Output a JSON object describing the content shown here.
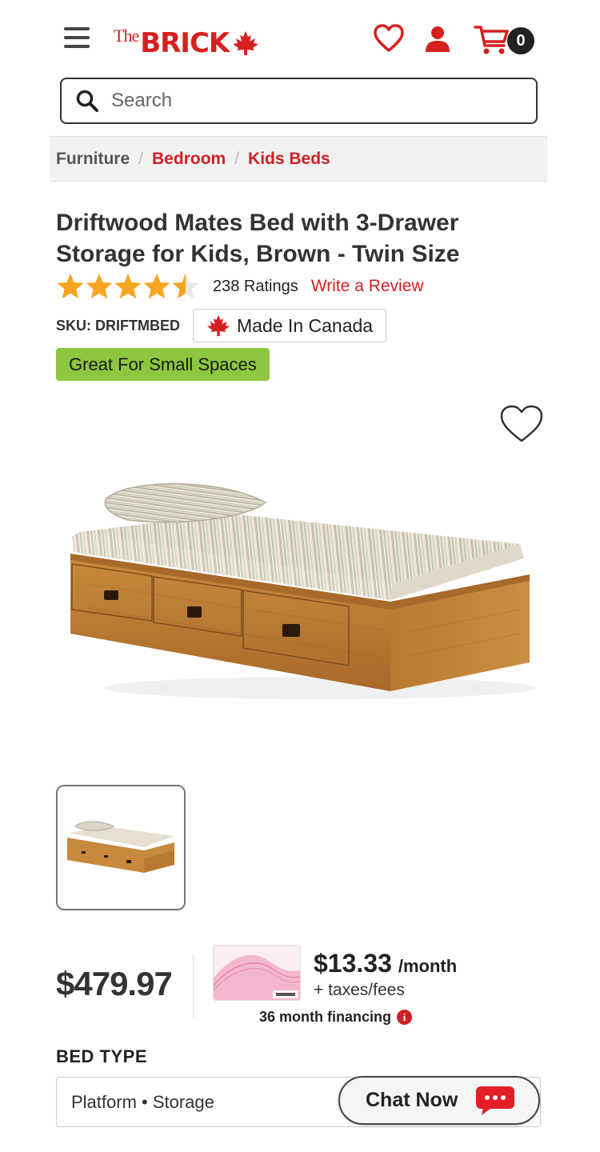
{
  "header": {
    "logo_the": "The",
    "logo_brick": "BRICK",
    "cart_count": "0",
    "menu_icon": "hamburger-menu-icon",
    "wishlist_icon": "heart-icon",
    "account_icon": "user-icon",
    "cart_icon": "cart-icon",
    "brand_color": "#d6201f"
  },
  "search": {
    "placeholder": "Search",
    "icon": "search-icon"
  },
  "breadcrumb": {
    "items": [
      {
        "label": "Furniture"
      },
      {
        "label": "Bedroom"
      },
      {
        "label": "Kids Beds"
      }
    ],
    "separator": "/"
  },
  "product": {
    "title": "Driftwood Mates Bed with 3-Drawer Storage for Kids, Brown - Twin Size",
    "rating_value": 4.5,
    "ratings_count": "238 Ratings",
    "write_review": "Write a Review",
    "sku": "SKU: DRIFTMBED",
    "made_in": "Made In Canada",
    "tag": "Great For Small Spaces",
    "tag_color": "#8dc73f",
    "price": "$479.97",
    "monthly_amount": "$13.33",
    "monthly_per": "/month",
    "taxes": "+ taxes/fees",
    "financing": "36 month financing",
    "info_icon_glyph": "i"
  },
  "options": {
    "bed_type_label": "BED TYPE",
    "bed_type_value": "Platform • Storage"
  },
  "chat": {
    "label": "Chat Now",
    "icon": "chat-bubble-icon"
  }
}
